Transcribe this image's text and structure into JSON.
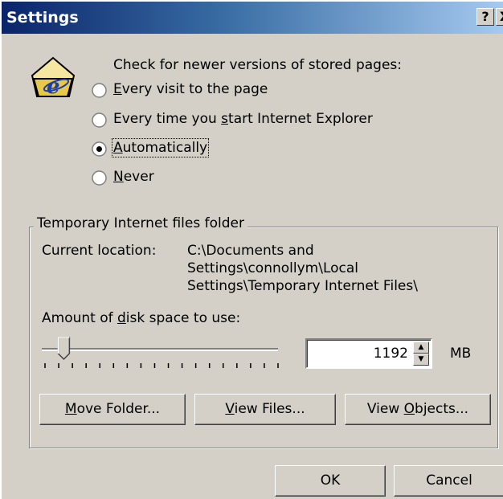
{
  "window": {
    "title": "Settings",
    "help_label": "?",
    "close_label": "X"
  },
  "check": {
    "heading": "Check for newer versions of stored pages:",
    "options": [
      {
        "label": "Every visit to the page",
        "accesskey": "E",
        "rest": "very visit to the page",
        "selected": false
      },
      {
        "label": "Every time you start Internet Explorer",
        "pre": "Every time you ",
        "accesskey": "s",
        "rest": "tart Internet Explorer",
        "selected": false
      },
      {
        "label": "Automatically",
        "accesskey": "A",
        "rest": "utomatically",
        "selected": true
      },
      {
        "label": "Never",
        "accesskey": "N",
        "rest": "ever",
        "selected": false
      }
    ]
  },
  "temp_folder": {
    "legend": "Temporary Internet files folder",
    "location_label": "Current location:",
    "location_lines": [
      "C:\\Documents and",
      "Settings\\connollym\\Local",
      "Settings\\Temporary Internet Files\\"
    ],
    "disk_label_pre": "Amount of ",
    "disk_label_key": "d",
    "disk_label_post": "isk space to use:",
    "disk_value": "1192",
    "disk_unit": "MB",
    "slider_level": 0.06
  },
  "buttons": {
    "move_pre": "",
    "move_key": "M",
    "move_post": "ove Folder...",
    "view_files_pre": "",
    "view_files_key": "V",
    "view_files_post": "iew Files...",
    "view_objects_pre": "View ",
    "view_objects_key": "O",
    "view_objects_post": "bjects...",
    "ok": "OK",
    "cancel": "Cancel"
  },
  "colors": {
    "title_start": "#0a246a",
    "title_end": "#a6caf0",
    "face": "#d4d0c8"
  }
}
